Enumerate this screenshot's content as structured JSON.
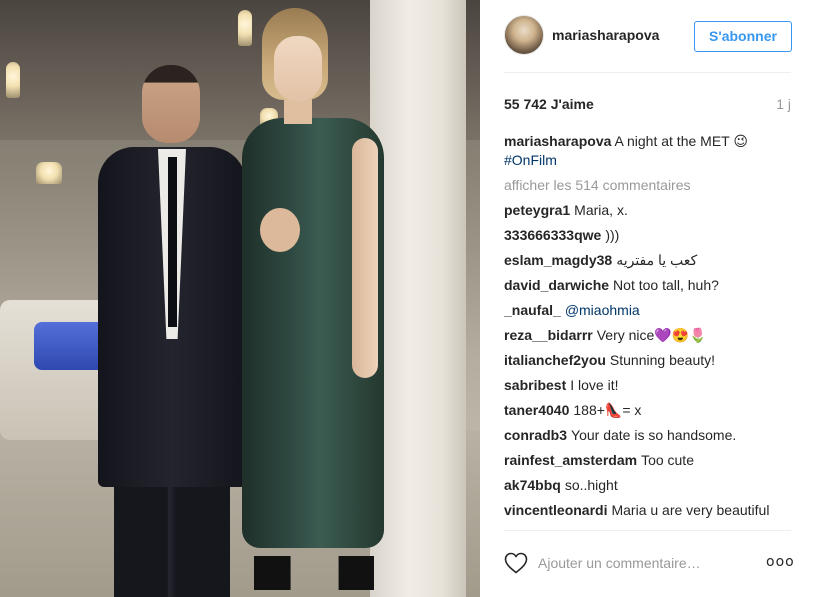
{
  "post": {
    "image_alt": "",
    "header": {
      "username": "mariasharapova",
      "follow_label": "S'abonner"
    },
    "likes": "55 742 J'aime",
    "time": "1 j",
    "caption": {
      "user": "mariasharapova",
      "text": "A night at the MET",
      "emoji": "😉",
      "hashtag": "#OnFilm"
    },
    "view_all": "afficher les 514 commentaires",
    "comments": [
      {
        "user": "peteygra1",
        "text": "Maria, x."
      },
      {
        "user": "333666333qwe",
        "text": ")))"
      },
      {
        "user": "eslam_magdy38",
        "text": "كعب يا مفتريه"
      },
      {
        "user": "david_darwiche",
        "text": "Not too tall, huh?"
      },
      {
        "user": "_naufal_",
        "text": "@miaohmia"
      },
      {
        "user": "reza__bidarrr",
        "text": "Very nice💜😍🌷"
      },
      {
        "user": "italianchef2you",
        "text": "Stunning beauty!"
      },
      {
        "user": "sabribest",
        "text": "I love it!"
      },
      {
        "user": "taner4040",
        "text": "188+👠= x"
      },
      {
        "user": "conradb3",
        "text": "Your date is so handsome."
      },
      {
        "user": "rainfest_amsterdam",
        "text": "Too cute"
      },
      {
        "user": "ak74bbq",
        "text": "so..hight"
      },
      {
        "user": "vincentleonardi",
        "text": "Maria u are very beautiful"
      }
    ],
    "add_comment_placeholder": "Ajouter un commentaire…",
    "more_label": "ooo",
    "colors": {
      "accent": "#3897f0",
      "hashtag": "#003569",
      "muted": "#999999",
      "text": "#262626"
    }
  }
}
